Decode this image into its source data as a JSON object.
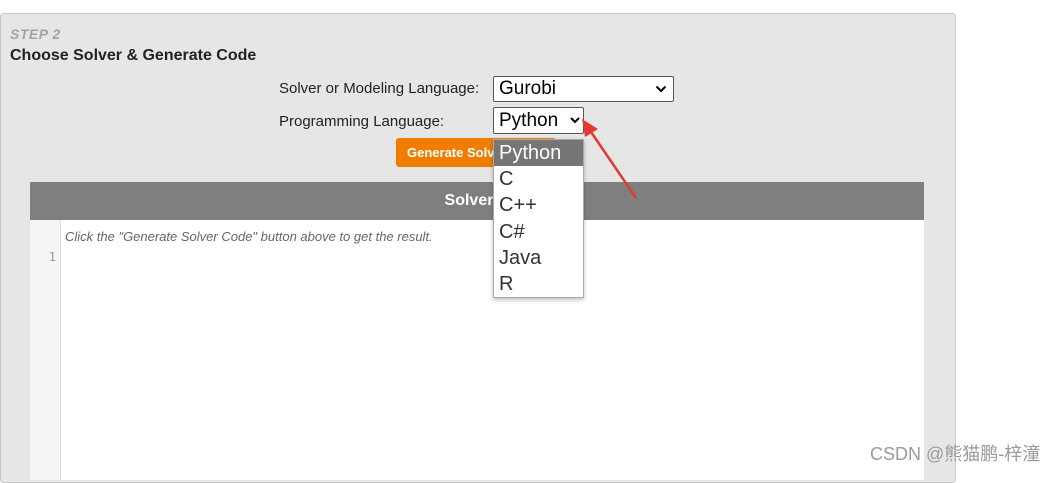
{
  "step": {
    "label": "STEP 2",
    "title": "Choose Solver & Generate Code"
  },
  "form": {
    "solver_label": "Solver or Modeling Language:",
    "solver_value": "Gurobi",
    "language_label": "Programming Language:",
    "language_value": "Python",
    "generate_button": "Generate Solv"
  },
  "dropdown": {
    "options": [
      "Python",
      "C",
      "C++",
      "C#",
      "Java",
      "R"
    ],
    "selected": "Python"
  },
  "code_panel": {
    "header": "Solver C",
    "placeholder": "Click the \"Generate Solver Code\" button above to get the result.",
    "line_number": "1"
  },
  "colors": {
    "accent_button": "#f07d00",
    "annotation_arrow": "#e53935",
    "selected_option": "#767676"
  },
  "watermark": "CSDN @熊猫鹏-梓潼"
}
